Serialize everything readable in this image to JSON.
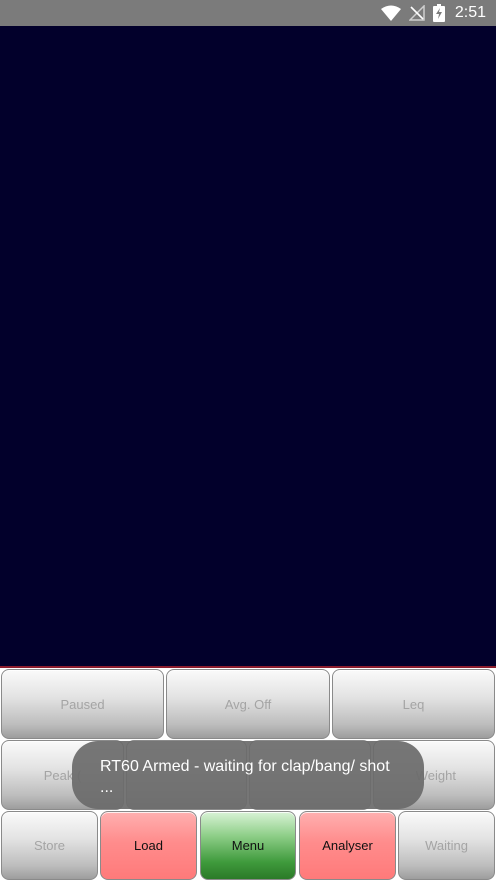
{
  "status_bar": {
    "time": "2:51",
    "icons": [
      "wifi-icon",
      "no-signal-icon",
      "battery-charging-icon"
    ]
  },
  "colors": {
    "plot_background": "#02002b",
    "plot_border": "#8c1d2e",
    "button_grey": "#cfcfcf",
    "button_red": "#ff8c8c",
    "button_green": "#4fa84b",
    "toast_background": "#6a6a6a"
  },
  "buttons": {
    "row1": {
      "paused": "Paused",
      "avg_off": "Avg. Off",
      "leq": "Leq"
    },
    "row2": {
      "peak": "Peak (",
      "weight": "Weight"
    },
    "row3": {
      "store": "Store",
      "load": "Load",
      "menu": "Menu",
      "analyser": "Analyser",
      "waiting": "Waiting"
    }
  },
  "toast": {
    "message": "RT60 Armed - waiting for clap/bang/ shot ..."
  }
}
